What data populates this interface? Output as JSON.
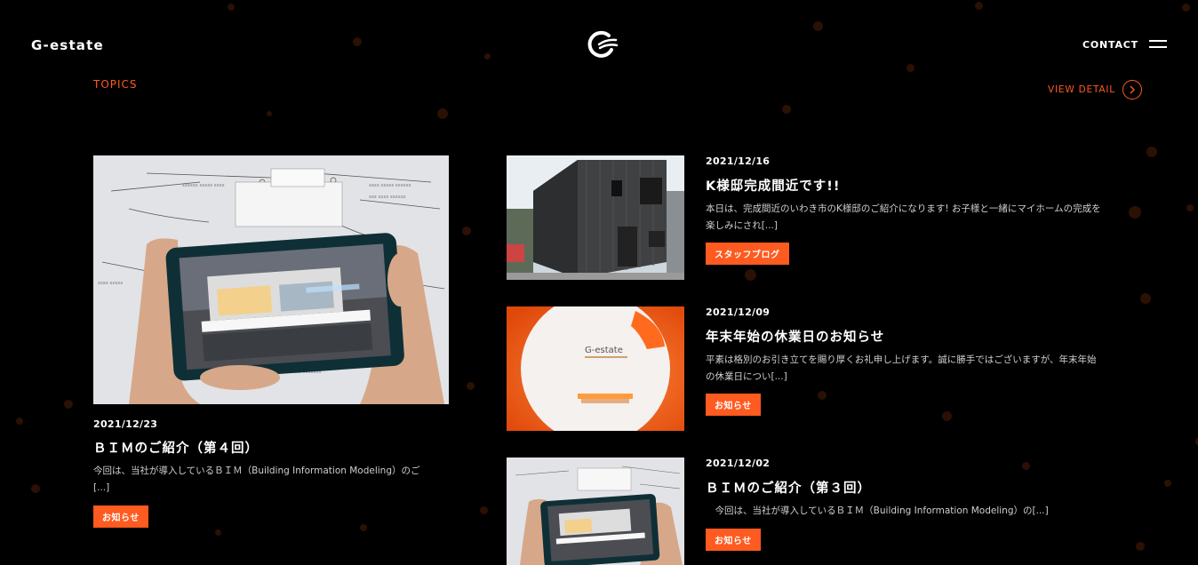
{
  "header": {
    "site_name": "G-estate",
    "contact_label": "CONTACT",
    "menu_icon": "hamburger-menu-icon",
    "logo_icon": "g-estate-logo-icon"
  },
  "section": {
    "title": "TOPICS",
    "view_detail_label": "VIEW DETAIL"
  },
  "colors": {
    "accent": "#ff5a1f",
    "background": "#000000"
  },
  "featured": {
    "date": "2021/12/23",
    "title": "ＢＩＭのご紹介（第４回）",
    "excerpt": "今回は、当社が導入しているＢＩＭ（Building Information Modeling）のご[...]",
    "tag": "お知らせ"
  },
  "articles": [
    {
      "date": "2021/12/16",
      "title": "K様邸完成間近です!!",
      "excerpt": "本日は、完成間近のいわき市のK様邸のご紹介になります! お子様と一緒にマイホームの完成を楽しみにされ[...]",
      "tag": "スタッフブログ"
    },
    {
      "date": "2021/12/09",
      "title": "年末年始の休業日のお知らせ",
      "excerpt": "平素は格別のお引き立てを賜り厚くお礼申し上げます。誠に勝手ではございますが、年末年始の休業日につい[...]",
      "tag": "お知らせ",
      "sign_text": "G-estate"
    },
    {
      "date": "2021/12/02",
      "title": "ＢＩＭのご紹介（第３回）",
      "excerpt": "　今回は、当社が導入しているＢＩＭ（Building Information Modeling）の[...]",
      "tag": "お知らせ"
    }
  ]
}
